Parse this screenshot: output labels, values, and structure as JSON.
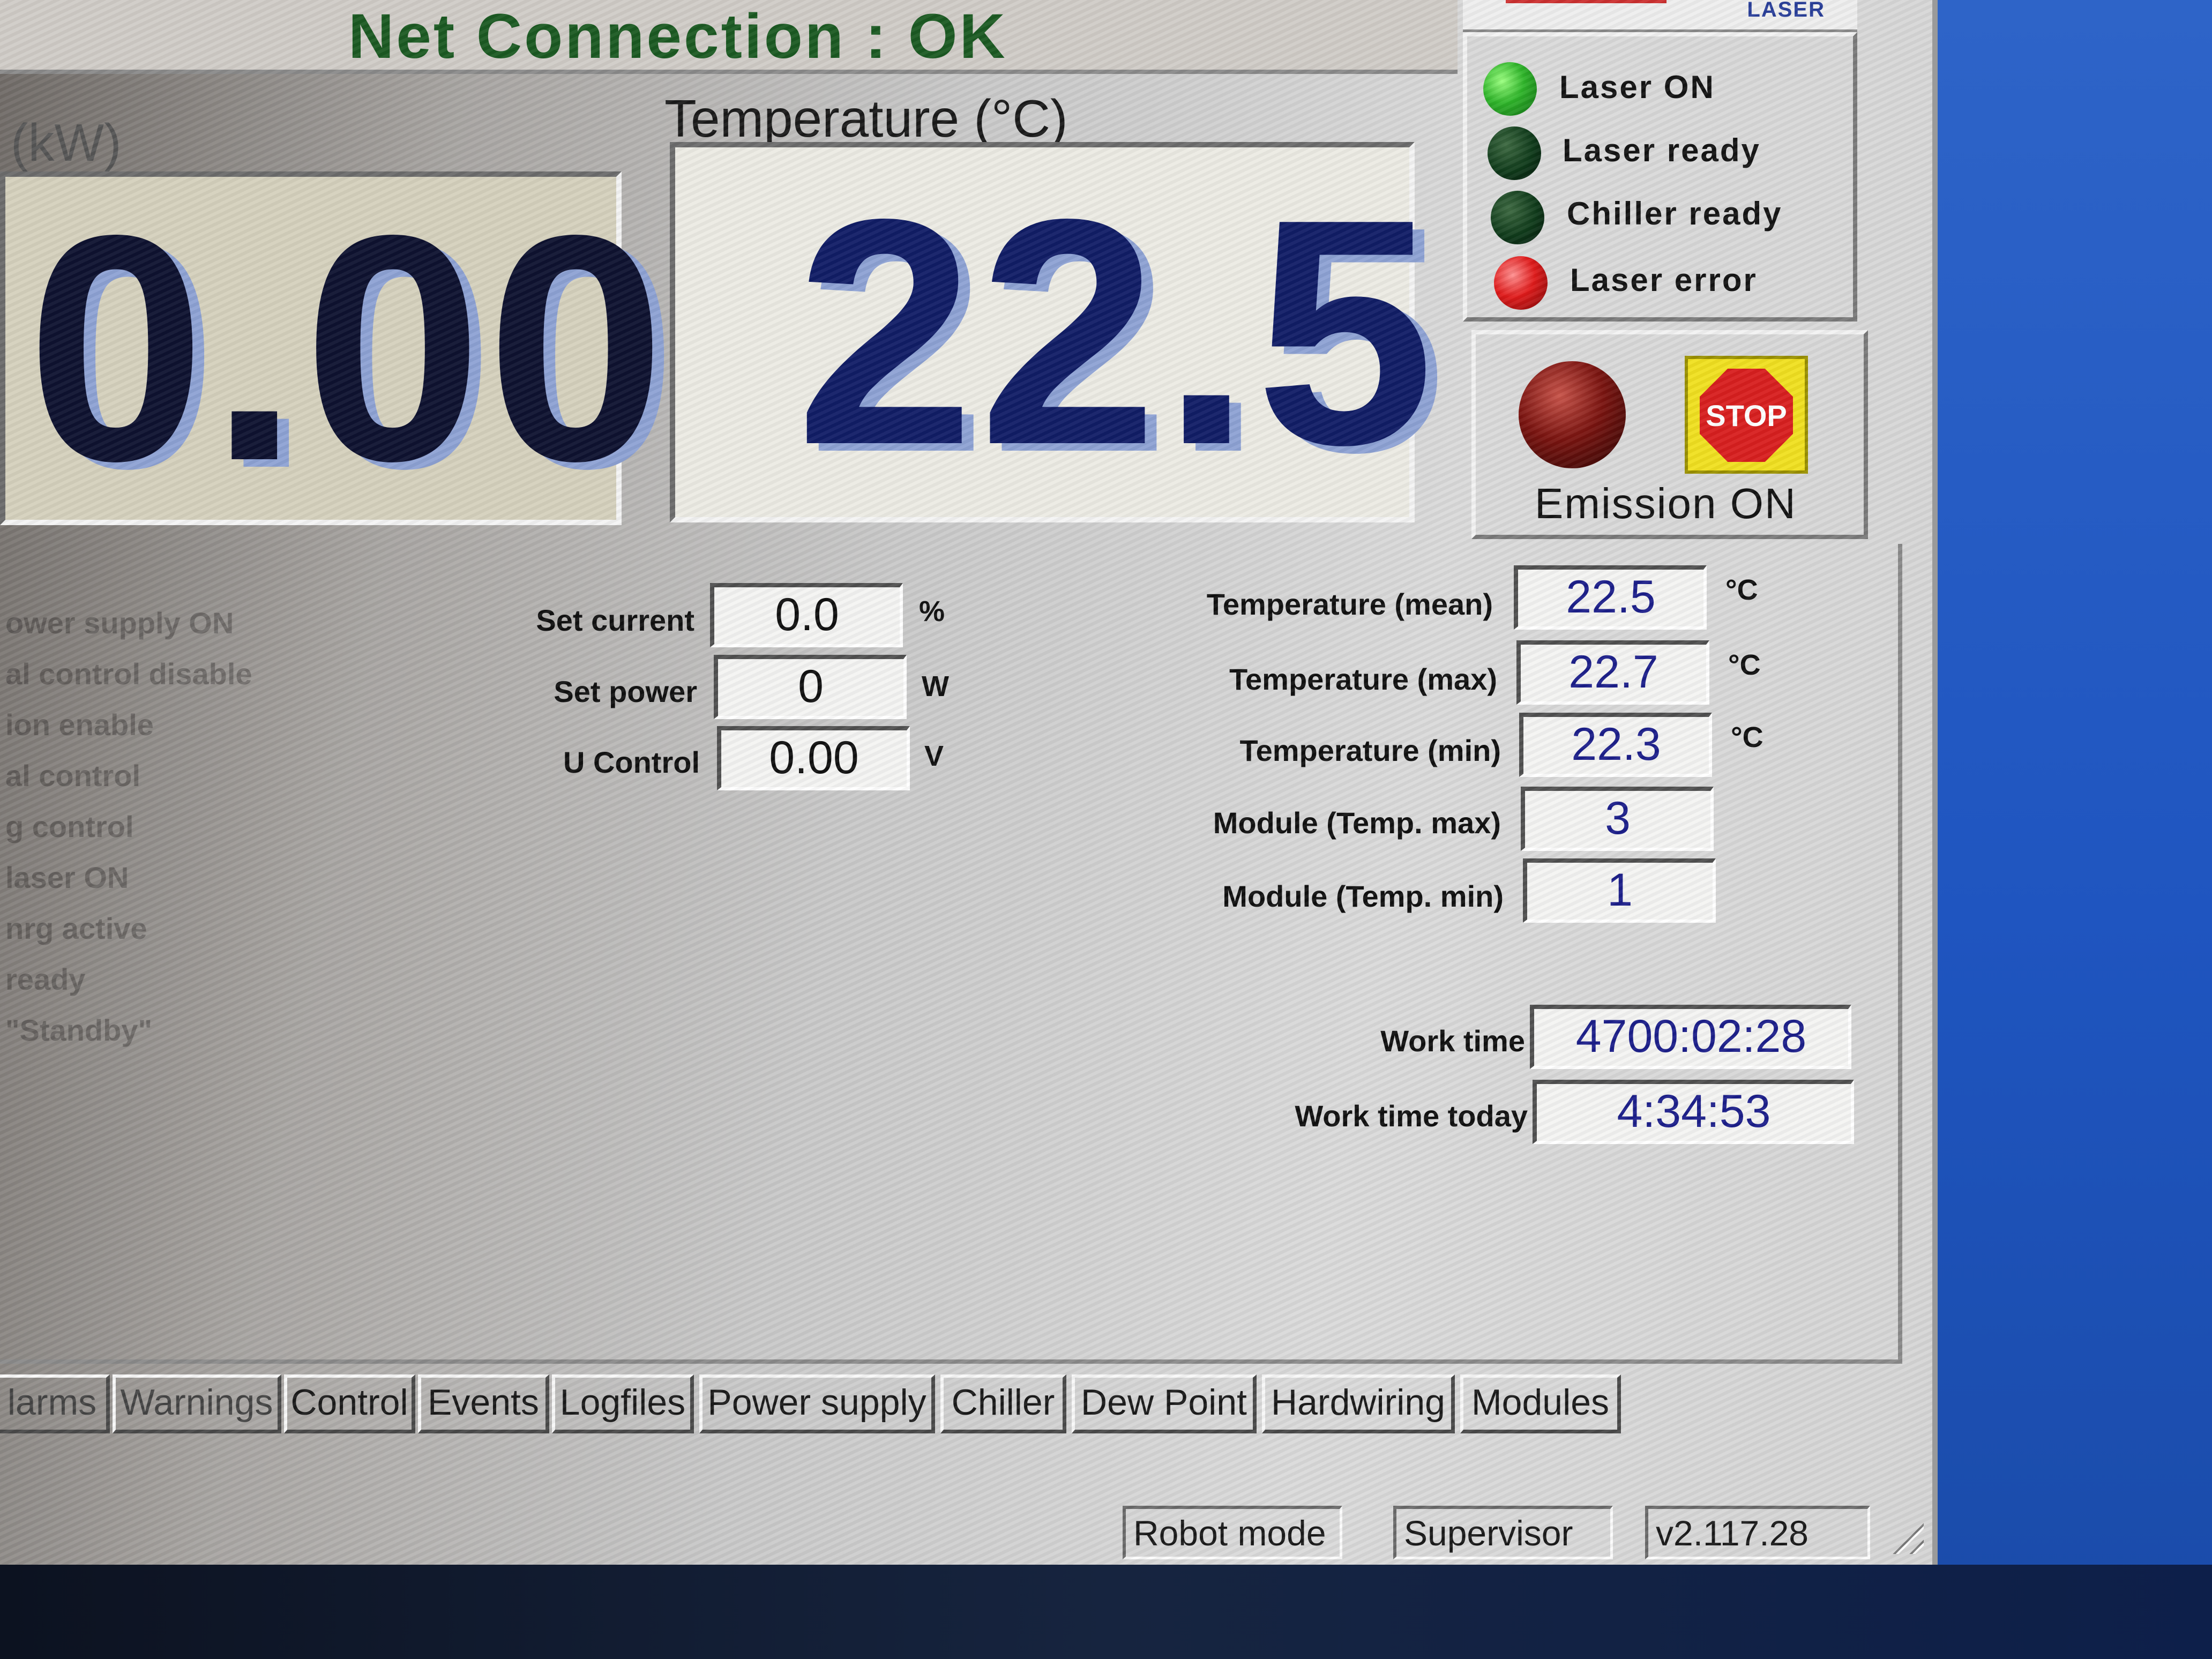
{
  "header": {
    "net_connection": "Net Connection : OK",
    "logo_text": "LASER"
  },
  "power": {
    "label": "r (kW)",
    "value": "0.00"
  },
  "temperature": {
    "label": "Temperature (°C)",
    "value": "22.5"
  },
  "status_leds": [
    {
      "label": "Laser ON",
      "state": "on",
      "color": "#2fb52a"
    },
    {
      "label": "Laser ready",
      "state": "off",
      "color": "#0f3a1a"
    },
    {
      "label": "Chiller ready",
      "state": "off",
      "color": "#0f3a1a"
    },
    {
      "label": "Laser error",
      "state": "on",
      "color": "#e01b1b"
    }
  ],
  "emission": {
    "label": "Emission ON",
    "stop_label": "STOP",
    "indicator_color": "#7a1410",
    "stop_color": "#d81f1f",
    "stop_bg": "#f0e020"
  },
  "left_status_faded": [
    "ower supply ON",
    "al control disable",
    "ion enable",
    "al control",
    "g control",
    "laser ON",
    "nrg active",
    "ready",
    "\"Standby\""
  ],
  "setpoints": {
    "set_current": {
      "label": "Set current",
      "value": "0.0",
      "unit": "%"
    },
    "set_power": {
      "label": "Set power",
      "value": "0",
      "unit": "W"
    },
    "u_control": {
      "label": "U Control",
      "value": "0.00",
      "unit": "V"
    }
  },
  "temps": {
    "mean": {
      "label": "Temperature (mean)",
      "value": "22.5",
      "unit": "°C"
    },
    "max": {
      "label": "Temperature (max)",
      "value": "22.7",
      "unit": "°C"
    },
    "min": {
      "label": "Temperature (min)",
      "value": "22.3",
      "unit": "°C"
    },
    "module_max": {
      "label": "Module (Temp. max)",
      "value": "3"
    },
    "module_min": {
      "label": "Module (Temp. min)",
      "value": "1"
    }
  },
  "work": {
    "total": {
      "label": "Work time",
      "value": "4700:02:28"
    },
    "today": {
      "label": "Work time today",
      "value": "4:34:53"
    }
  },
  "tabs": [
    "larms",
    "Warnings",
    "Control",
    "Events",
    "Logfiles",
    "Power supply",
    "Chiller",
    "Dew Point",
    "Hardwiring",
    "Modules"
  ],
  "statusbar": {
    "mode": "Robot mode",
    "user": "Supervisor",
    "version": "v2.117.28"
  }
}
